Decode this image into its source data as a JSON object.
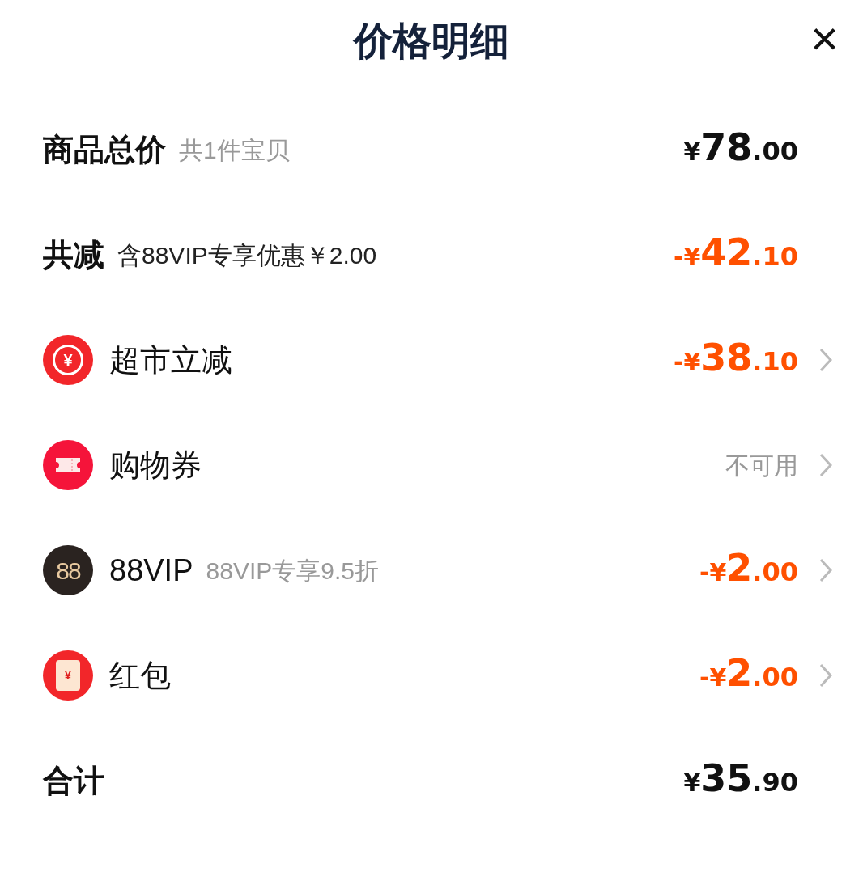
{
  "header": {
    "title": "价格明细",
    "close_label": "×"
  },
  "rows": [
    {
      "kind": "summary",
      "label": "商品总价",
      "note": "共1件宝贝",
      "note_dark": false,
      "negative": false,
      "amount": {
        "prefix": "¥",
        "main": "78",
        "cents": ".00"
      }
    },
    {
      "kind": "summary",
      "label": "共减",
      "note": "含88VIP专享优惠￥2.00",
      "note_dark": true,
      "negative": true,
      "amount": {
        "prefix": "-¥",
        "main": "42",
        "cents": ".10"
      }
    },
    {
      "kind": "promo",
      "icon_text": "¥",
      "label": "超市立减",
      "negative": true,
      "amount": {
        "prefix": "-¥",
        "main": "38",
        "cents": ".10"
      }
    },
    {
      "kind": "coupon",
      "label": "购物券",
      "status": "不可用"
    },
    {
      "kind": "vip",
      "icon_text": "88",
      "label": "88VIP",
      "note": "88VIP专享9.5折",
      "note_dark": false,
      "negative": true,
      "amount": {
        "prefix": "-¥",
        "main": "2",
        "cents": ".00"
      }
    },
    {
      "kind": "envelope",
      "icon_text": "¥",
      "label": "红包",
      "negative": true,
      "amount": {
        "prefix": "-¥",
        "main": "2",
        "cents": ".00"
      }
    },
    {
      "kind": "summary",
      "label": "合计",
      "negative": false,
      "amount": {
        "prefix": "¥",
        "main": "35",
        "cents": ".90"
      }
    }
  ]
}
